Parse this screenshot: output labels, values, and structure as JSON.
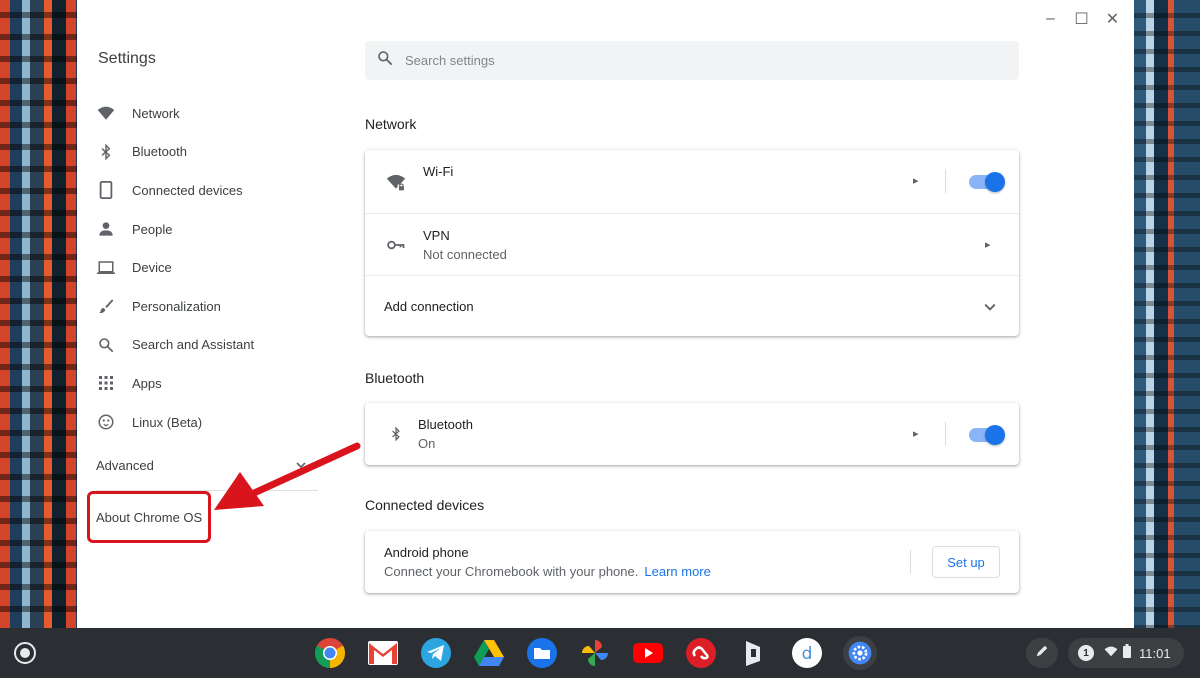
{
  "app": {
    "title": "Settings"
  },
  "window_controls": {
    "minimize": "–",
    "maximize": "☐",
    "close": "✕"
  },
  "search": {
    "placeholder": "Search settings"
  },
  "sidebar": {
    "items": [
      {
        "label": "Network",
        "icon": "wifi-icon"
      },
      {
        "label": "Bluetooth",
        "icon": "bluetooth-icon"
      },
      {
        "label": "Connected devices",
        "icon": "phone-icon"
      },
      {
        "label": "People",
        "icon": "person-icon"
      },
      {
        "label": "Device",
        "icon": "laptop-icon"
      },
      {
        "label": "Personalization",
        "icon": "brush-icon"
      },
      {
        "label": "Search and Assistant",
        "icon": "search-icon"
      },
      {
        "label": "Apps",
        "icon": "apps-grid-icon"
      },
      {
        "label": "Linux (Beta)",
        "icon": "linux-icon"
      }
    ],
    "advanced": "Advanced",
    "about": "About Chrome OS"
  },
  "sections": {
    "network": {
      "title": "Network",
      "wifi": {
        "label": "Wi-Fi",
        "enabled": true
      },
      "vpn": {
        "label": "VPN",
        "status": "Not connected"
      },
      "add_connection": "Add connection"
    },
    "bluetooth": {
      "title": "Bluetooth",
      "label": "Bluetooth",
      "status": "On",
      "enabled": true
    },
    "connected_devices": {
      "title": "Connected devices",
      "label": "Android phone",
      "description": "Connect your Chromebook with your phone.",
      "link": "Learn more",
      "button": "Set up"
    }
  },
  "shelf": {
    "apps": [
      "chrome-icon",
      "gmail-icon",
      "telegram-icon",
      "drive-icon",
      "files-icon",
      "photos-icon",
      "youtube-icon",
      "creative-cloud-icon",
      "dashlane-icon",
      "dictionary-icon",
      "settings-gear-icon"
    ],
    "notification_count": "1",
    "time": "11:01"
  },
  "colors": {
    "accent": "#1a73e8",
    "highlight": "#d9141c",
    "shelf": "#2b2f33"
  }
}
